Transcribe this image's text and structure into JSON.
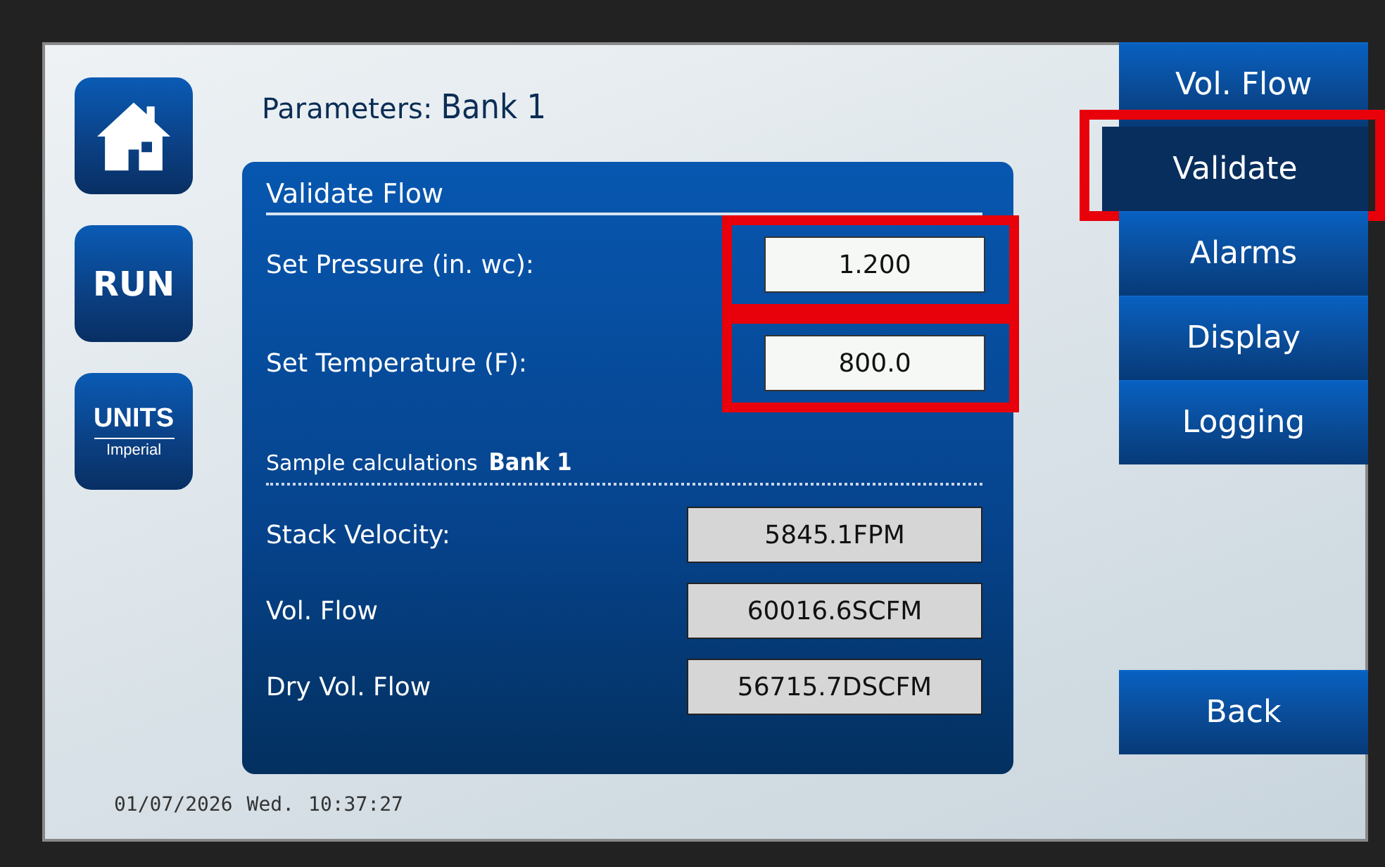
{
  "nav_buttons": [
    {
      "kind": "home"
    },
    {
      "kind": "text",
      "label": "RUN"
    },
    {
      "kind": "units",
      "label": "UNITS",
      "sublabel": "Imperial"
    }
  ],
  "title": {
    "label": "Parameters:",
    "bank": "Bank 1"
  },
  "panel": {
    "heading": "Validate Flow",
    "inputs": [
      {
        "label": "Set Pressure (in. wc):",
        "value": "1.200",
        "highlighted": true
      },
      {
        "label": "Set Temperature (F):",
        "value": "800.0",
        "highlighted": true
      }
    ],
    "sample": {
      "label": "Sample calculations",
      "bank": "Bank 1"
    },
    "outputs": [
      {
        "label": "Stack Velocity:",
        "value": "5845.1FPM"
      },
      {
        "label": "Vol. Flow",
        "value": "60016.6SCFM"
      },
      {
        "label": "Dry Vol. Flow",
        "value": "56715.7DSCFM"
      }
    ]
  },
  "tabs": [
    {
      "label": "Vol. Flow",
      "selected": false,
      "highlighted": false
    },
    {
      "label": "Validate",
      "selected": true,
      "highlighted": true
    },
    {
      "label": "Alarms",
      "selected": false,
      "highlighted": false
    },
    {
      "label": "Display",
      "selected": false,
      "highlighted": false
    },
    {
      "label": "Logging",
      "selected": false,
      "highlighted": false
    }
  ],
  "back_button": "Back",
  "status": {
    "date": "01/07/2026",
    "day": "Wed.",
    "time": "10:37:27"
  }
}
